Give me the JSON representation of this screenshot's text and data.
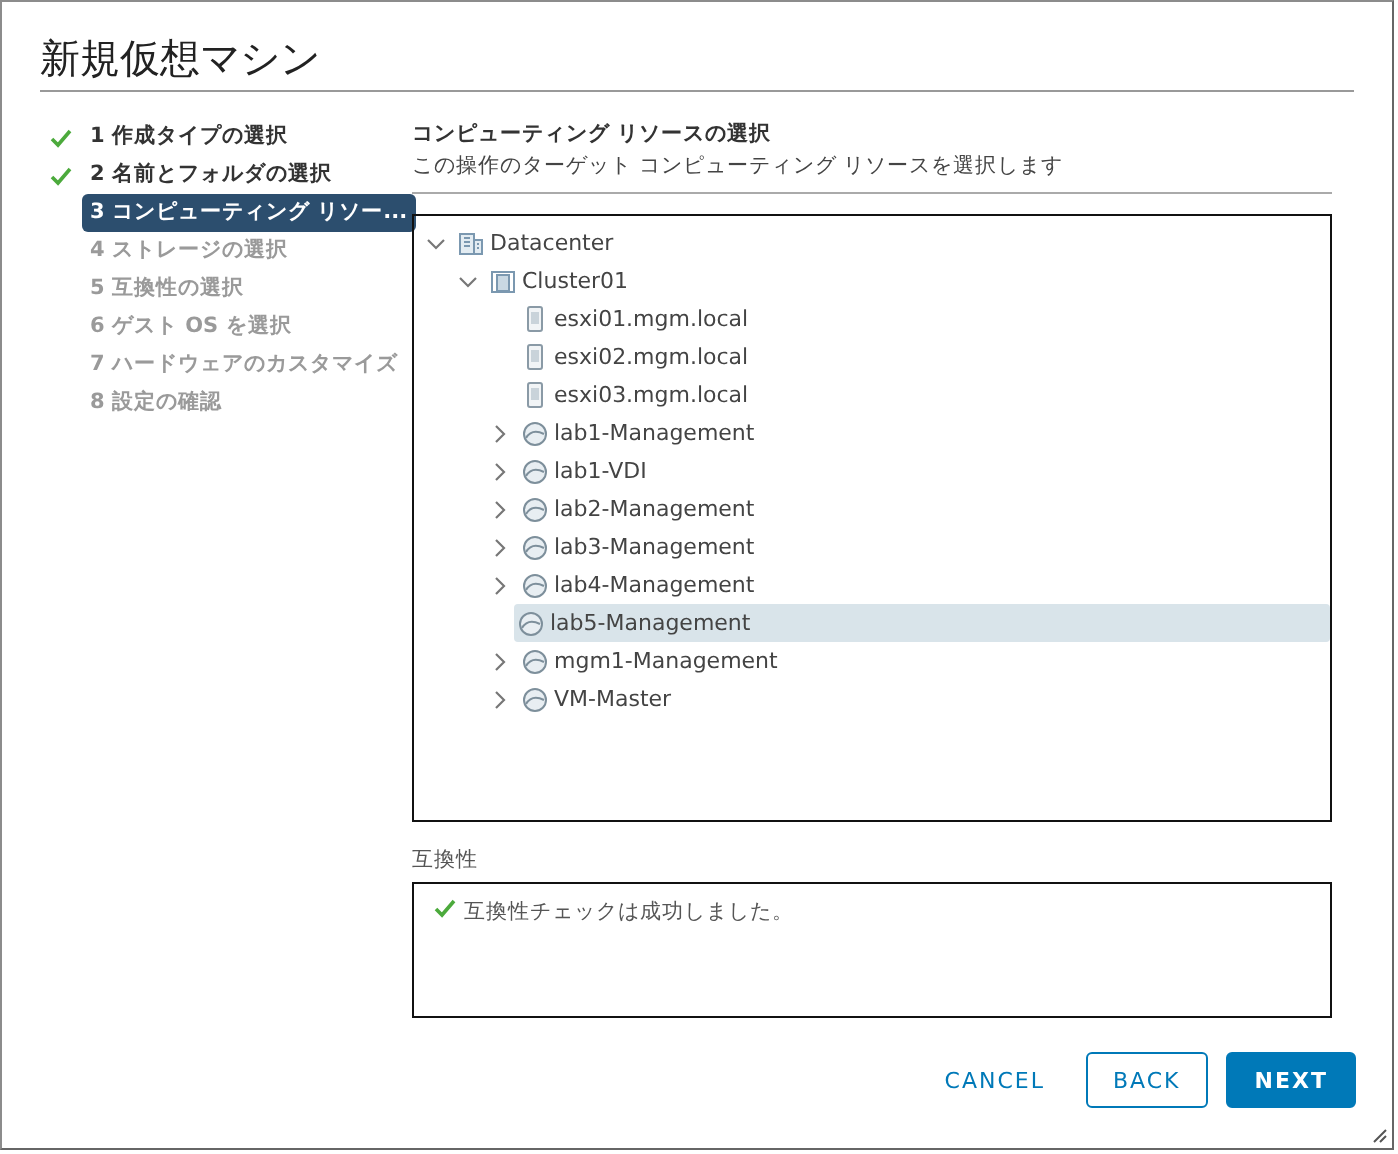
{
  "window": {
    "title": "新規仮想マシン"
  },
  "steps": [
    {
      "label": "1 作成タイプの選択",
      "done": true,
      "selected": false,
      "disabled": false
    },
    {
      "label": "2 名前とフォルダの選択",
      "done": true,
      "selected": false,
      "disabled": false
    },
    {
      "label": "3 コンピューティング リソー...",
      "done": false,
      "selected": true,
      "disabled": false
    },
    {
      "label": "4 ストレージの選択",
      "done": false,
      "selected": false,
      "disabled": true
    },
    {
      "label": "5 互換性の選択",
      "done": false,
      "selected": false,
      "disabled": true
    },
    {
      "label": "6 ゲスト OS を選択",
      "done": false,
      "selected": false,
      "disabled": true
    },
    {
      "label": "7 ハードウェアのカスタマイズ",
      "done": false,
      "selected": false,
      "disabled": true
    },
    {
      "label": "8 設定の確認",
      "done": false,
      "selected": false,
      "disabled": true
    }
  ],
  "page": {
    "heading": "コンピューティング リソースの選択",
    "subtitle": "この操作のターゲット コンピューティング リソースを選択します"
  },
  "tree": [
    {
      "label": "Datacenter",
      "kind": "datacenter",
      "expanded": true,
      "selected": false,
      "children": [
        {
          "label": "Cluster01",
          "kind": "cluster",
          "expanded": true,
          "selected": false,
          "children": [
            {
              "label": "esxi01.mgm.local",
              "kind": "host",
              "selected": false
            },
            {
              "label": "esxi02.mgm.local",
              "kind": "host",
              "selected": false
            },
            {
              "label": "esxi03.mgm.local",
              "kind": "host",
              "selected": false
            },
            {
              "label": "lab1-Management",
              "kind": "pool",
              "expanded": false,
              "selected": false
            },
            {
              "label": "lab1-VDI",
              "kind": "pool",
              "expanded": false,
              "selected": false
            },
            {
              "label": "lab2-Management",
              "kind": "pool",
              "expanded": false,
              "selected": false
            },
            {
              "label": "lab3-Management",
              "kind": "pool",
              "expanded": false,
              "selected": false
            },
            {
              "label": "lab4-Management",
              "kind": "pool",
              "expanded": false,
              "selected": false
            },
            {
              "label": "lab5-Management",
              "kind": "pool",
              "selected": true
            },
            {
              "label": "mgm1-Management",
              "kind": "pool",
              "expanded": false,
              "selected": false
            },
            {
              "label": "VM-Master",
              "kind": "pool",
              "expanded": false,
              "selected": false
            }
          ]
        }
      ]
    }
  ],
  "compatibility": {
    "label": "互換性",
    "message": "互換性チェックは成功しました。",
    "ok": true
  },
  "buttons": [
    {
      "label": "CANCEL",
      "kind": "flat"
    },
    {
      "label": "BACK",
      "kind": "outline"
    },
    {
      "label": "NEXT",
      "kind": "primary"
    }
  ]
}
